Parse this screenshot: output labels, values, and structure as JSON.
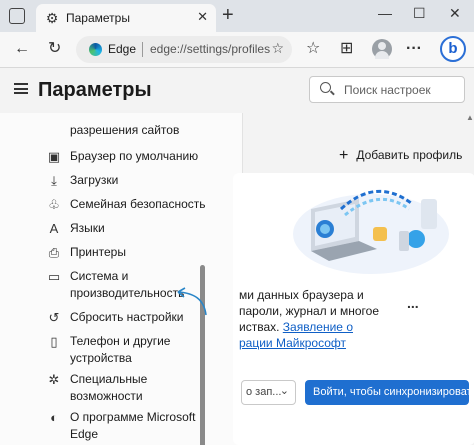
{
  "tab": {
    "title": "Параметры",
    "close": "✕",
    "new": "+"
  },
  "window": {
    "minimize": "—",
    "maximize": "☐",
    "close": "✕"
  },
  "toolbar": {
    "back": "←",
    "refresh": "↻",
    "brand": "Edge",
    "url": "edge://settings/profiles",
    "favorite_add": "☆",
    "favorites": "☆",
    "collections": "⊞",
    "more": "···",
    "copilot": "b"
  },
  "settings": {
    "title": "Параметры",
    "search_placeholder": "Поиск настроек"
  },
  "sidebar": {
    "items": [
      {
        "label": "разрешения сайтов",
        "icon": ""
      },
      {
        "label": "Браузер по умолчанию",
        "icon": "browser-icon"
      },
      {
        "label": "Загрузки",
        "icon": "download-icon"
      },
      {
        "label": "Семейная безопасность",
        "icon": "family-icon"
      },
      {
        "label": "Языки",
        "icon": "language-icon"
      },
      {
        "label": "Принтеры",
        "icon": "printer-icon"
      },
      {
        "label": "Система и",
        "label2": "производительность",
        "icon": "laptop-icon"
      },
      {
        "label": "Сбросить настройки",
        "icon": "reset-icon"
      },
      {
        "label": "Телефон и другие",
        "label2": "устройства",
        "icon": "phone-icon"
      },
      {
        "label": "Специальные",
        "label2": "возможности",
        "icon": "accessibility-icon"
      },
      {
        "label": "О программе Microsoft",
        "label2": "Edge",
        "icon": "edge-icon"
      }
    ]
  },
  "profile": {
    "add_profile": "Добавить профиль",
    "line1": "ми данных браузера и",
    "line2": "пароли, журнал и многое",
    "line3_prefix": "иствах. ",
    "line3_link": "Заявление о",
    "line4_link": "рации Майкрософт",
    "more": "...",
    "dropdown": "о зап...",
    "sync_button": "Войти, чтобы синхронизировать данные"
  },
  "colors": {
    "accent": "#1f6fd0",
    "link": "#0f5fc6",
    "sidebar_bg": "#fbfbfb",
    "page_bg": "#f3f3f3"
  }
}
